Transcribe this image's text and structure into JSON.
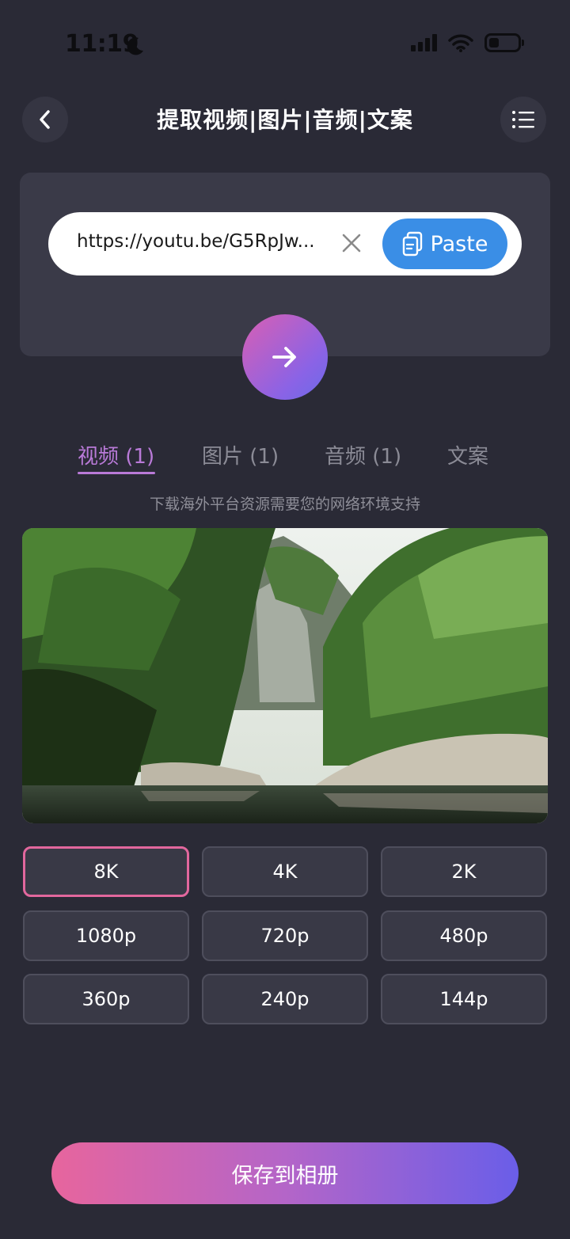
{
  "status_bar": {
    "time": "11:19"
  },
  "header": {
    "title": "提取视频|图片|音频|文案"
  },
  "url_input": {
    "value": "https://youtu.be/G5RpJw..."
  },
  "paste_button": {
    "label": "Paste"
  },
  "tabs": [
    {
      "label": "视频 (1)",
      "active": true
    },
    {
      "label": "图片 (1)",
      "active": false
    },
    {
      "label": "音频 (1)",
      "active": false
    },
    {
      "label": "文案",
      "active": false
    }
  ],
  "notice": "下载海外平台资源需要您的网络环境支持",
  "qualities": [
    "8K",
    "4K",
    "2K",
    "1080p",
    "720p",
    "480p",
    "360p",
    "240p",
    "144p"
  ],
  "selected_quality": "8K",
  "save_button": {
    "label": "保存到相册"
  },
  "colors": {
    "background": "#2a2a36",
    "accent_pink": "#e2679d",
    "accent_purple": "#b97ad8",
    "paste_blue": "#3a8ee6"
  },
  "icons": [
    "moon-icon",
    "cellular-signal-icon",
    "wifi-icon",
    "battery-icon",
    "back-chevron-icon",
    "list-menu-icon",
    "clear-x-icon",
    "clipboard-icon",
    "arrow-right-icon"
  ]
}
